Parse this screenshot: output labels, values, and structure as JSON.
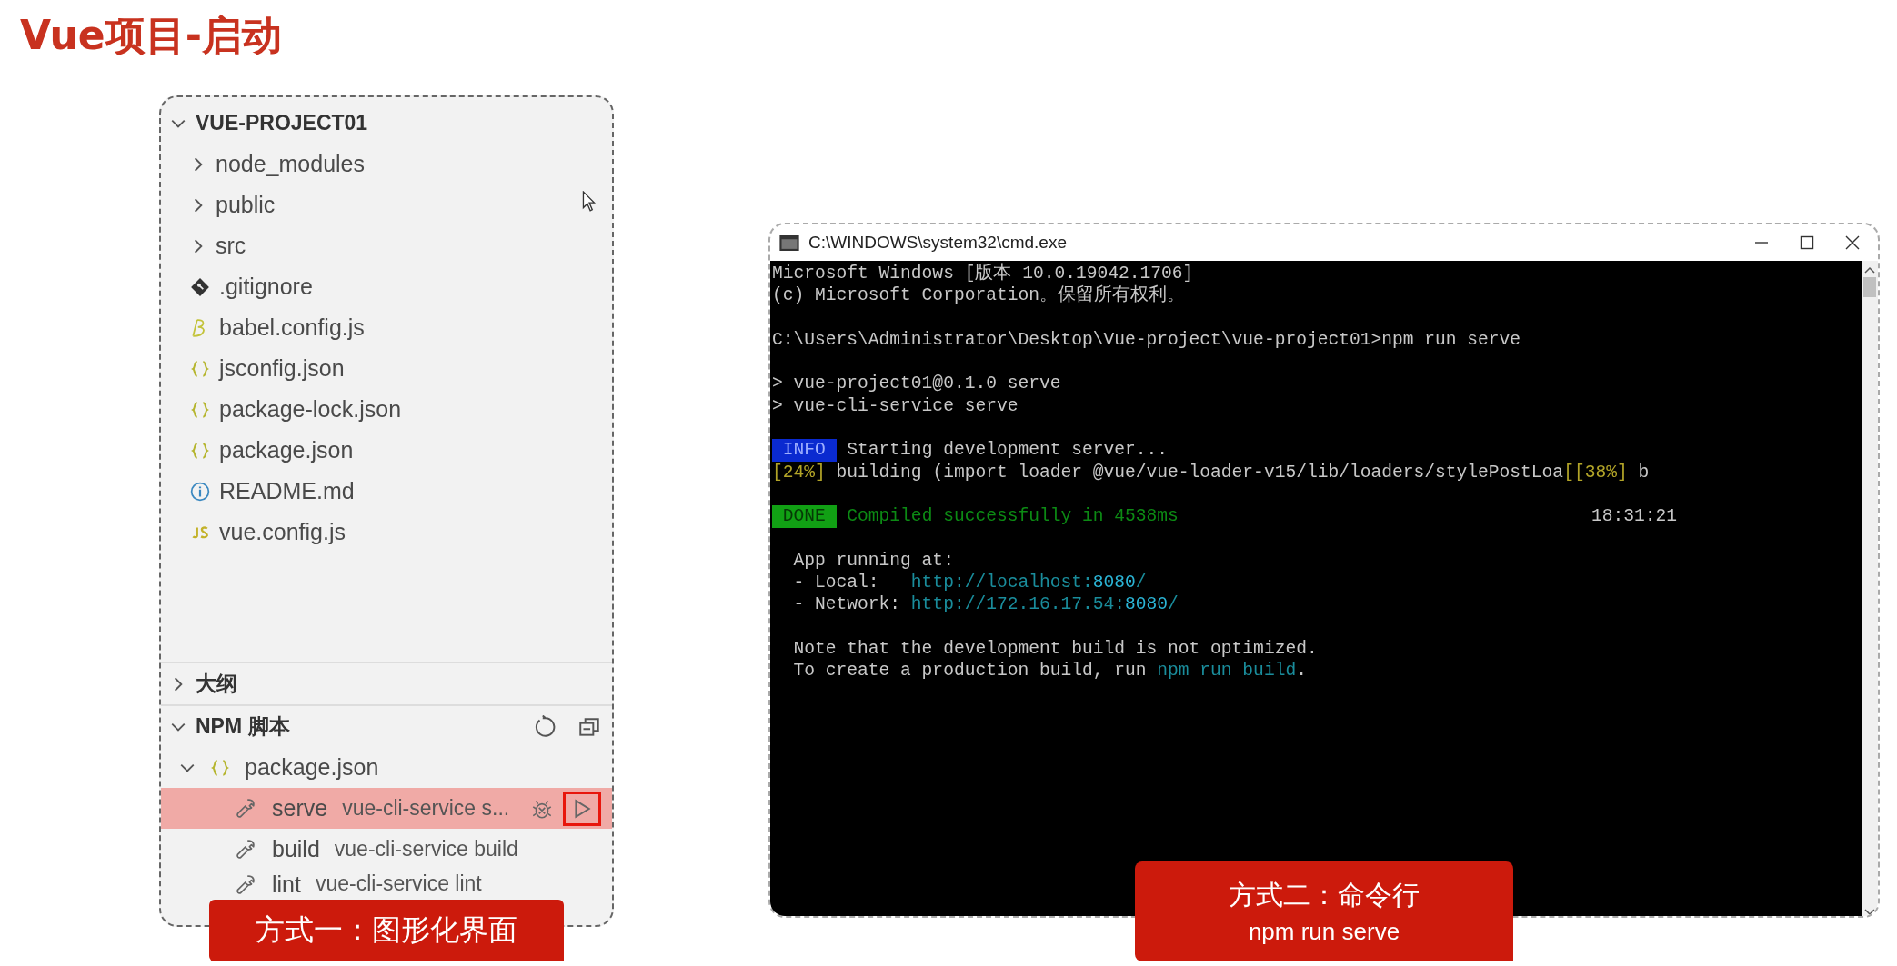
{
  "title": "Vue项目-启动",
  "explorer": {
    "project": "VUE-PROJECT01",
    "expanded": true,
    "items": [
      {
        "kind": "folder",
        "name": "node_modules",
        "expanded": false
      },
      {
        "kind": "folder",
        "name": "public",
        "expanded": false
      },
      {
        "kind": "folder",
        "name": "src",
        "expanded": false
      },
      {
        "kind": "git",
        "name": ".gitignore"
      },
      {
        "kind": "babel",
        "name": "babel.config.js"
      },
      {
        "kind": "json",
        "name": "jsconfig.json"
      },
      {
        "kind": "json",
        "name": "package-lock.json"
      },
      {
        "kind": "json",
        "name": "package.json"
      },
      {
        "kind": "info",
        "name": "README.md"
      },
      {
        "kind": "js",
        "name": "vue.config.js"
      }
    ]
  },
  "outline": {
    "title": "大纲",
    "expanded": false
  },
  "npm": {
    "title": "NPM 脚本",
    "expanded": true,
    "file": {
      "name": "package.json",
      "expanded": true
    },
    "scripts": [
      {
        "name": "serve",
        "command": "vue-cli-service s...",
        "selected": true
      },
      {
        "name": "build",
        "command": "vue-cli-service build",
        "selected": false
      },
      {
        "name": "lint",
        "command": "vue-cli-service lint",
        "selected": false
      }
    ]
  },
  "label_left": {
    "text": "方式一：图形化界面"
  },
  "cmd": {
    "title": "C:\\WINDOWS\\system32\\cmd.exe",
    "lines": [
      {
        "kind": "text",
        "segments": [
          {
            "kind": "plain",
            "text": "Microsoft Windows [版本 10.0.19042.1706]"
          }
        ]
      },
      {
        "kind": "text",
        "segments": [
          {
            "kind": "plain",
            "text": "(c) Microsoft Corporation。保留所有权利。"
          }
        ]
      },
      {
        "kind": "blank"
      },
      {
        "kind": "text",
        "segments": [
          {
            "kind": "plain",
            "text": "C:\\Users\\Administrator\\Desktop\\Vue-project\\vue-project01>npm run serve"
          }
        ]
      },
      {
        "kind": "blank"
      },
      {
        "kind": "text",
        "segments": [
          {
            "kind": "plain",
            "text": "> vue-project01@0.1.0 serve"
          }
        ]
      },
      {
        "kind": "text",
        "segments": [
          {
            "kind": "plain",
            "text": "> vue-cli-service serve"
          }
        ]
      },
      {
        "kind": "blank"
      },
      {
        "kind": "text",
        "segments": [
          {
            "kind": "info",
            "text": " INFO "
          },
          {
            "kind": "plain",
            "text": " Starting development server..."
          }
        ]
      },
      {
        "kind": "text",
        "segments": [
          {
            "kind": "yellow",
            "text": "[24%]"
          },
          {
            "kind": "plain",
            "text": " building (import loader @vue/vue-loader-v15/lib/loaders/stylePostLoa"
          },
          {
            "kind": "yellow",
            "text": "[[38%]"
          },
          {
            "kind": "plain",
            "text": " b"
          }
        ]
      },
      {
        "kind": "blank"
      },
      {
        "kind": "text",
        "segments": [
          {
            "kind": "done",
            "text": " DONE "
          },
          {
            "kind": "green",
            "text": " Compiled successfully in 4538ms"
          },
          {
            "kind": "time",
            "text": "18:31:21"
          }
        ]
      },
      {
        "kind": "blank"
      },
      {
        "kind": "text",
        "segments": [
          {
            "kind": "plain",
            "text": "  App running at:"
          }
        ]
      },
      {
        "kind": "text",
        "segments": [
          {
            "kind": "plain",
            "text": "  - Local:   "
          },
          {
            "kind": "link",
            "text": "http://localhost:"
          },
          {
            "kind": "port",
            "text": "8080"
          },
          {
            "kind": "link",
            "text": "/"
          }
        ]
      },
      {
        "kind": "text",
        "segments": [
          {
            "kind": "plain",
            "text": "  - Network: "
          },
          {
            "kind": "link",
            "text": "http://172.16.17.54:"
          },
          {
            "kind": "port",
            "text": "8080"
          },
          {
            "kind": "link",
            "text": "/"
          }
        ]
      },
      {
        "kind": "blank"
      },
      {
        "kind": "text",
        "segments": [
          {
            "kind": "plain",
            "text": "  Note that the development build is not optimized."
          }
        ]
      },
      {
        "kind": "text",
        "segments": [
          {
            "kind": "plain",
            "text": "  To create a production build, run "
          },
          {
            "kind": "link",
            "text": "npm run build"
          },
          {
            "kind": "plain",
            "text": "."
          }
        ]
      }
    ]
  },
  "label_right": {
    "text": "方式二：命令行",
    "subtext": "npm run serve"
  }
}
